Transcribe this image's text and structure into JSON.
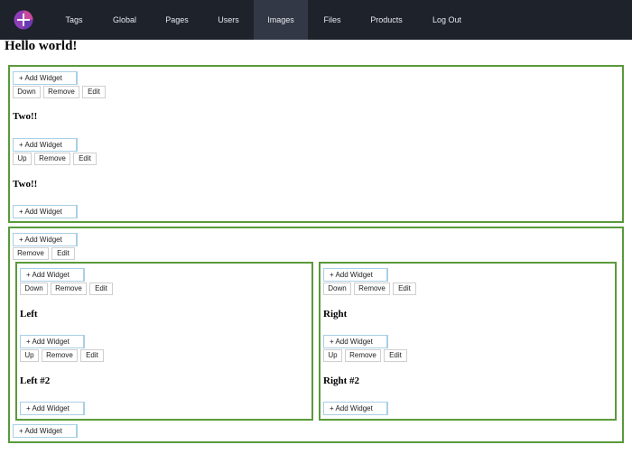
{
  "nav": {
    "items": [
      "Tags",
      "Global",
      "Pages",
      "Users",
      "Images",
      "Files",
      "Products",
      "Log Out"
    ],
    "active": "Images",
    "colors": {
      "background": "#1e222b",
      "active": "#333846",
      "logo": "#8e3fb8"
    },
    "logo_icon": "app-logo-icon"
  },
  "page": {
    "title": "Hello world!"
  },
  "labels": {
    "add_widget": "+ Add Widget",
    "up": "Up",
    "down": "Down",
    "remove": "Remove",
    "edit": "Edit"
  },
  "headings": {
    "two_a": "Two!!",
    "two_b": "Two!!",
    "left": "Left",
    "left2": "Left #2",
    "right": "Right",
    "right2": "Right #2"
  },
  "colors": {
    "border": "#5a9a3b",
    "add_border": "#a9cfe6"
  }
}
